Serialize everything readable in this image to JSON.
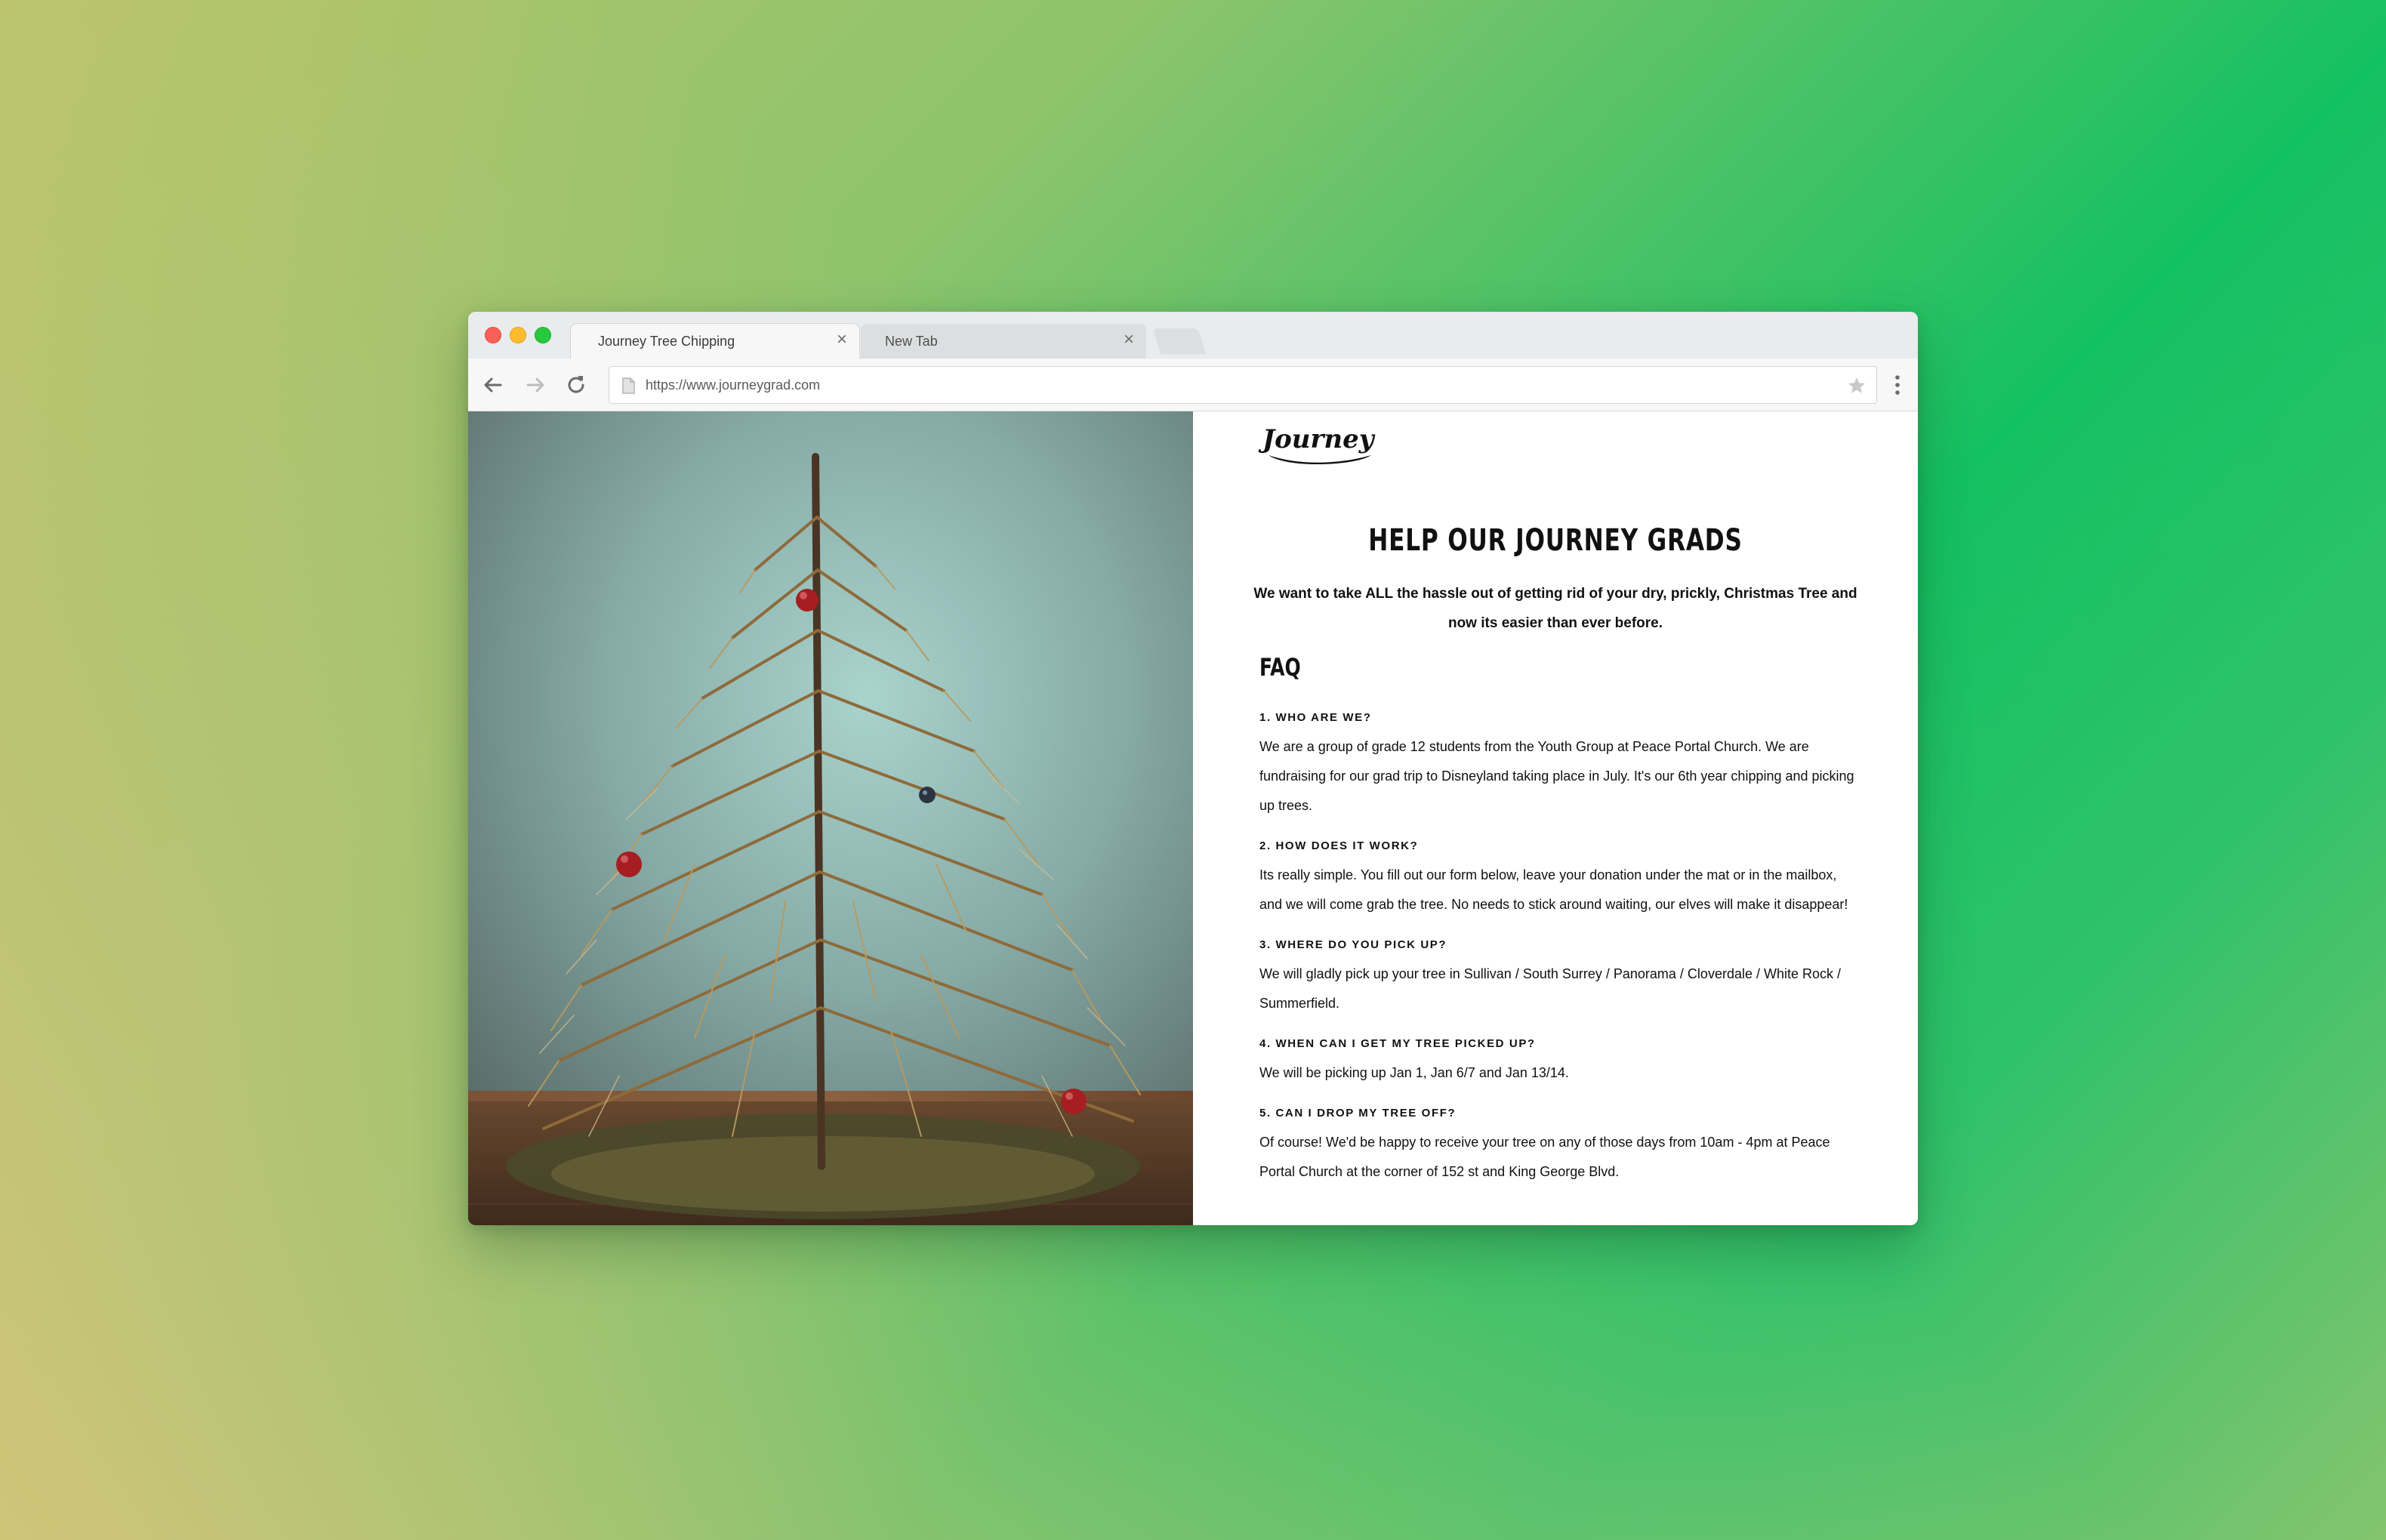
{
  "browser": {
    "tabs": [
      {
        "title": "Journey Tree Chipping",
        "close": "×"
      },
      {
        "title": "New Tab",
        "close": "×"
      }
    ],
    "url": "https://www.journeygrad.com"
  },
  "page": {
    "logo": "Journey",
    "headline": "HELP OUR JOURNEY GRADS",
    "intro": "We want to take ALL the hassle out of getting rid of your dry, prickly, Christmas Tree and now its easier than ever before.",
    "faq_heading": "FAQ",
    "faq": [
      {
        "q": "1. WHO ARE WE?",
        "a": "We are a group of grade 12 students from the Youth Group at Peace Portal Church. We are fundraising for our grad trip to Disneyland taking place in July. It's our 6th year chipping and picking up trees."
      },
      {
        "q": "2. HOW DOES IT WORK?",
        "a": "Its really simple. You fill out our form below, leave your donation under the mat or in the mailbox, and we will come grab the tree. No needs to stick around waiting, our elves will make it disappear!"
      },
      {
        "q": "3. WHERE DO YOU PICK UP?",
        "a": "We will gladly pick up your tree in Sullivan / South Surrey / Panorama / Cloverdale / White Rock / Summerfield."
      },
      {
        "q": "4. WHEN CAN I GET MY TREE PICKED UP?",
        "a": "We will be picking up Jan 1, Jan 6/7 and Jan 13/14."
      },
      {
        "q": "5. CAN I DROP MY TREE OFF?",
        "a": "Of course! We'd be happy to receive your tree on any of those days from 10am - 4pm at Peace Portal Church at the corner of 152 st and King George Blvd."
      }
    ]
  },
  "colors": {
    "close_dot": "#fc5f57",
    "minimize_dot": "#fdbc2e",
    "maximize_dot": "#28c840",
    "text": "#111111"
  },
  "icons": {
    "back": "arrow-left-icon",
    "forward": "arrow-right-icon",
    "reload": "reload-icon",
    "page": "page-icon",
    "bookmark": "star-icon",
    "menu": "kebab-menu-icon"
  }
}
